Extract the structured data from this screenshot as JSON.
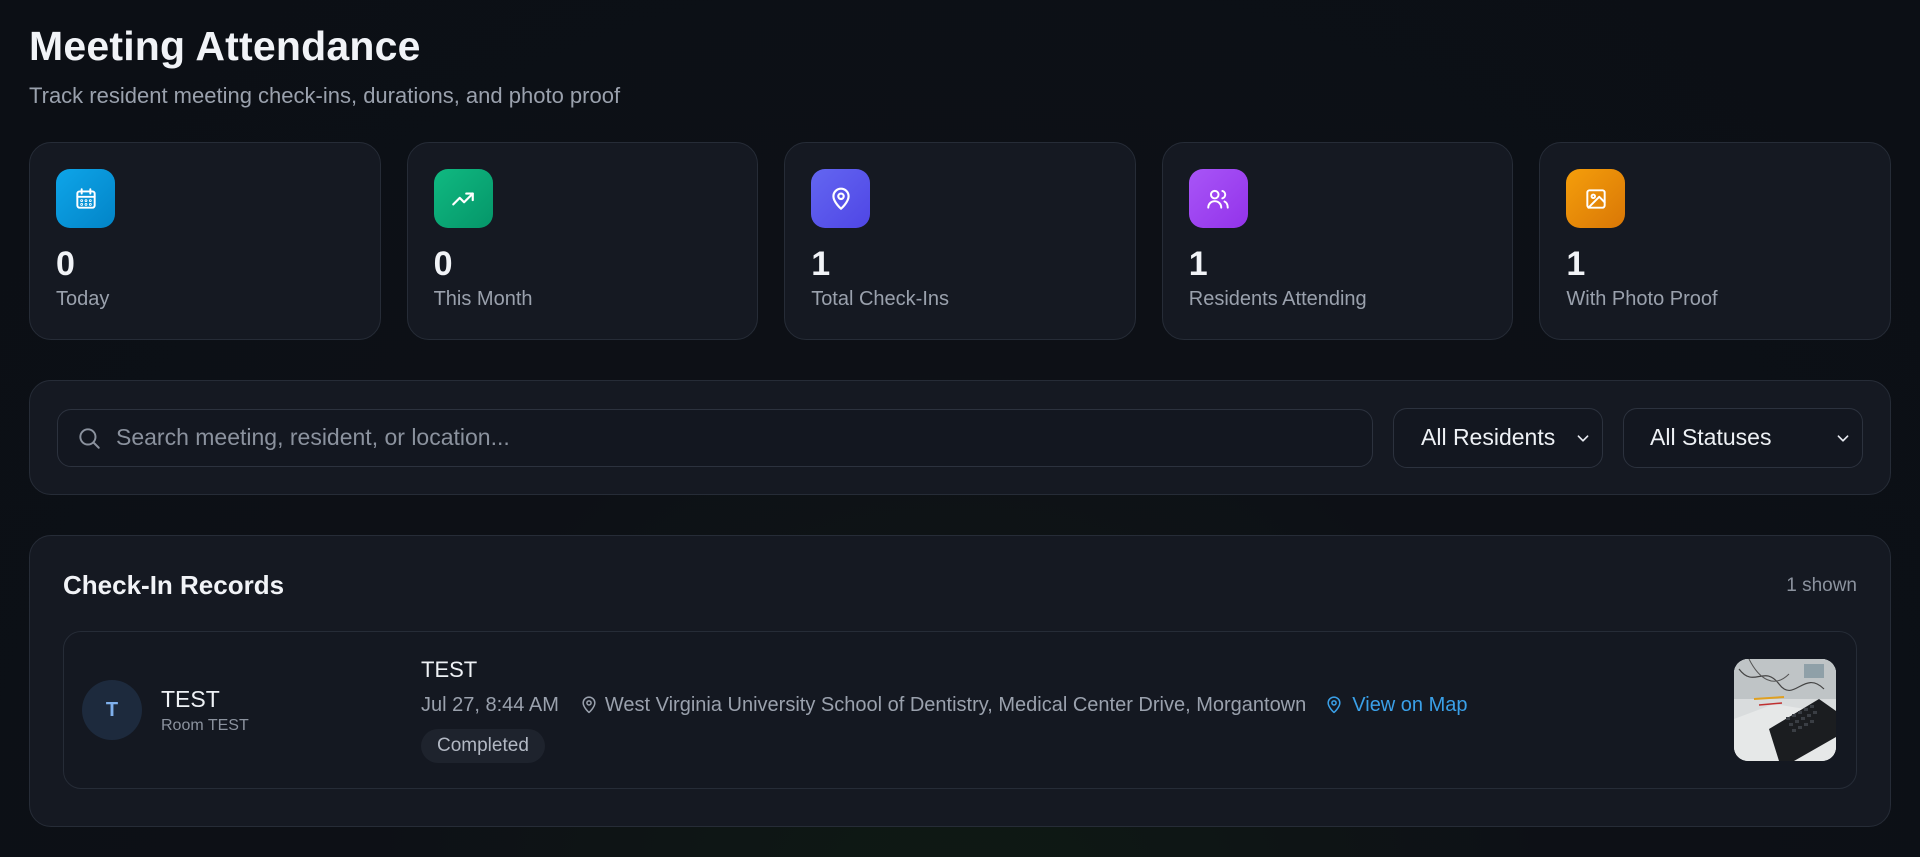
{
  "header": {
    "title": "Meeting Attendance",
    "subtitle": "Track resident meeting check-ins, durations, and photo proof"
  },
  "stats": [
    {
      "icon": "calendar-icon",
      "value": "0",
      "label": "Today",
      "color": "#0ea5e9"
    },
    {
      "icon": "trending-up-icon",
      "value": "0",
      "label": "This Month",
      "color": "#10b981"
    },
    {
      "icon": "map-pin-icon",
      "value": "1",
      "label": "Total Check-Ins",
      "color": "#6366f1"
    },
    {
      "icon": "users-icon",
      "value": "1",
      "label": "Residents Attending",
      "color": "#a855f7"
    },
    {
      "icon": "image-icon",
      "value": "1",
      "label": "With Photo Proof",
      "color": "#f59e0b"
    }
  ],
  "filters": {
    "search_placeholder": "Search meeting, resident, or location...",
    "resident_filter": "All Residents",
    "status_filter": "All Statuses"
  },
  "records": {
    "title": "Check-In Records",
    "count": "1 shown",
    "items": [
      {
        "avatar_initial": "T",
        "resident_name": "TEST",
        "room": "Room TEST",
        "meeting_name": "TEST",
        "datetime": "Jul 27, 8:44 AM",
        "location": "West Virginia University School of Dentistry, Medical Center Drive, Morgantown",
        "map_link": "View on Map",
        "status": "Completed"
      }
    ]
  },
  "colors": {
    "accent_link": "#3aa0e8",
    "card_bg": "#151922",
    "page_bg": "#0e1117"
  }
}
